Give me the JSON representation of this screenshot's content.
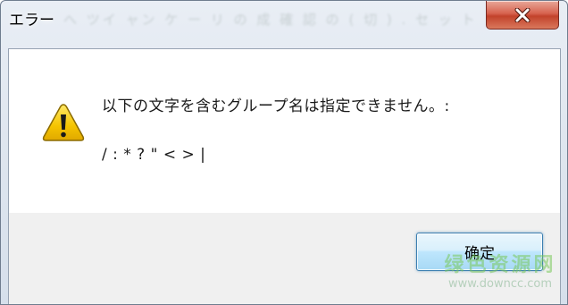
{
  "window": {
    "title": "エラー",
    "background_ghost_text": "へ  ツイ ャン ケ   ー リ の  成 確 認 の ( 切 )  . セ ッ ト"
  },
  "title_bar": {
    "close_icon": "close-icon",
    "close_color": "#c7442c"
  },
  "dialog": {
    "icon": "warning-icon",
    "message": "以下の文字を含むグループ名は指定できません。:",
    "invalid_chars": "/ : * ? \" < > |",
    "ok_label": "确定"
  },
  "watermark": {
    "title": "绿色资源网",
    "url": "www.downcc.com"
  },
  "colors": {
    "warning_fill": "#f5c400",
    "button_border": "#3c7fb1"
  }
}
